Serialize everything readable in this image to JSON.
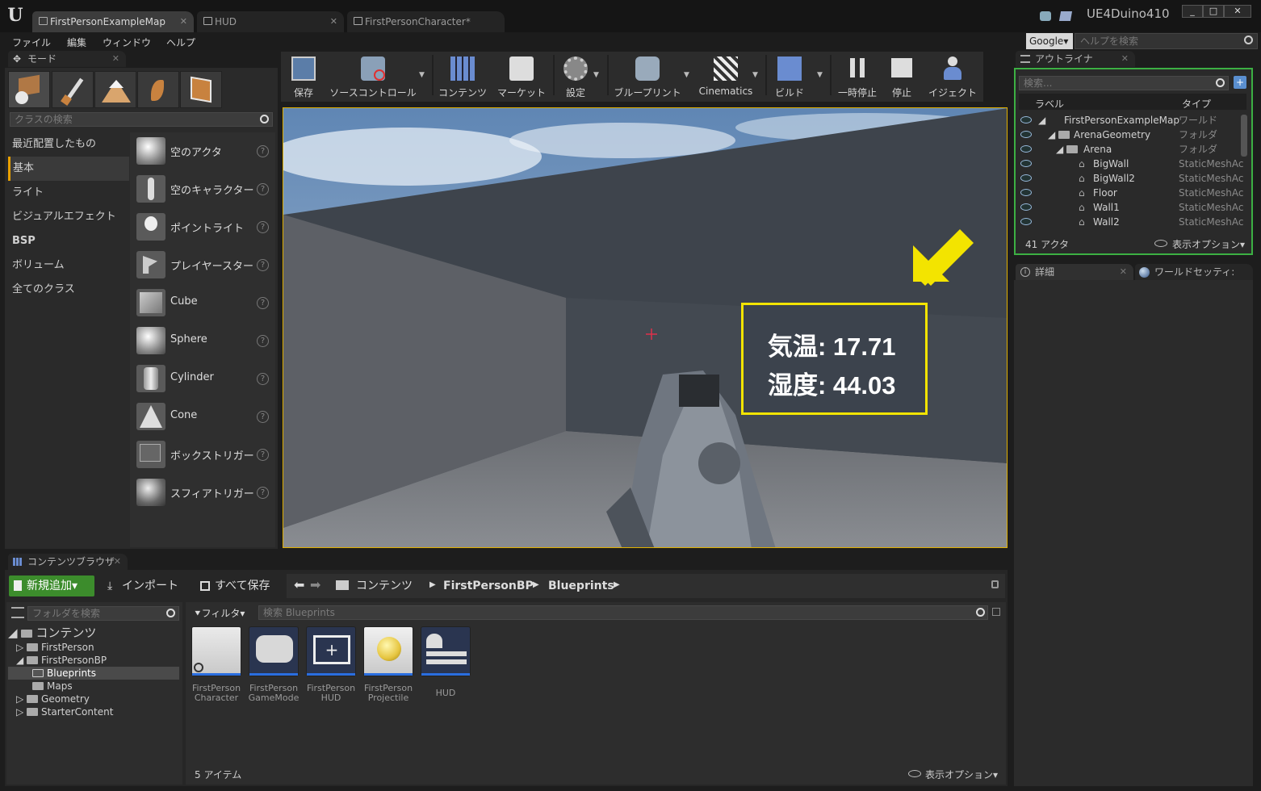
{
  "window": {
    "tabs": [
      {
        "label": "FirstPersonExampleMap"
      },
      {
        "label": "HUD"
      },
      {
        "label": "FirstPersonCharacter*"
      }
    ],
    "project_name": "UE4Duino410",
    "controls": [
      "_",
      "□",
      "✕"
    ]
  },
  "menu": {
    "items": [
      "ファイル",
      "編集",
      "ウィンドウ",
      "ヘルプ"
    ],
    "search_engine": "Google▾",
    "help_search_placeholder": "ヘルプを検索"
  },
  "modes_panel": {
    "title": "モード",
    "class_search_placeholder": "クラスの検索",
    "categories": [
      "最近配置したもの",
      "基本",
      "ライト",
      "ビジュアルエフェクト",
      "BSP",
      "ボリューム",
      "全てのクラス"
    ],
    "selected_category": "基本",
    "items": [
      {
        "label": "空のアクタ"
      },
      {
        "label": "空のキャラクター"
      },
      {
        "label": "ポイントライト"
      },
      {
        "label": "プレイヤースター"
      },
      {
        "label": "Cube"
      },
      {
        "label": "Sphere"
      },
      {
        "label": "Cylinder"
      },
      {
        "label": "Cone"
      },
      {
        "label": "ボックストリガー"
      },
      {
        "label": "スフィアトリガー"
      }
    ],
    "help_glyph": "?"
  },
  "toolbar": {
    "buttons": [
      {
        "label": "保存"
      },
      {
        "label": "ソースコントロール"
      },
      {
        "label": "コンテンツ"
      },
      {
        "label": "マーケット"
      },
      {
        "label": "設定"
      },
      {
        "label": "ブループリント"
      },
      {
        "label": "Cinematics"
      },
      {
        "label": "ビルド"
      },
      {
        "label": "一時停止"
      },
      {
        "label": "停止"
      },
      {
        "label": "イジェクト"
      }
    ]
  },
  "viewport": {
    "hud_lines": [
      "気温: 17.71",
      "湿度: 44.03"
    ],
    "highlight_color": "#f3e400",
    "arrow_color": "#f3e400"
  },
  "outliner": {
    "title": "アウトライナ",
    "search_placeholder": "検索...",
    "col_label": "ラベル",
    "col_type": "タイプ",
    "rows": [
      {
        "label": "FirstPersonExampleMap",
        "type": "ワールド"
      },
      {
        "label": "ArenaGeometry",
        "type": "フォルダ"
      },
      {
        "label": "Arena",
        "type": "フォルダ"
      },
      {
        "label": "BigWall",
        "type": "StaticMeshAc"
      },
      {
        "label": "BigWall2",
        "type": "StaticMeshAc"
      },
      {
        "label": "Floor",
        "type": "StaticMeshAc"
      },
      {
        "label": "Wall1",
        "type": "StaticMeshAc"
      },
      {
        "label": "Wall2",
        "type": "StaticMeshAc"
      }
    ],
    "actor_count": "41 アクタ",
    "view_options": "表示オプション▾"
  },
  "details": {
    "tab_details": "詳細",
    "tab_world_settings": "ワールドセッティ:"
  },
  "content_browser": {
    "title": "コンテンツブラウザ",
    "add_new": "新規追加▾",
    "import": "インポート",
    "save_all": "すべて保存",
    "path": [
      "コンテンツ",
      "FirstPersonBP",
      "Blueprints"
    ],
    "folder_search_placeholder": "フォルダを検索",
    "filter": "フィルタ▾",
    "asset_search_placeholder": "検索 Blueprints",
    "tree": [
      {
        "label": "コンテンツ"
      },
      {
        "label": "FirstPerson"
      },
      {
        "label": "FirstPersonBP"
      },
      {
        "label": "Blueprints"
      },
      {
        "label": "Maps"
      },
      {
        "label": "Geometry"
      },
      {
        "label": "StarterContent"
      }
    ],
    "assets": [
      {
        "line1": "FirstPerson",
        "line2": "Character"
      },
      {
        "line1": "FirstPerson",
        "line2": "GameMode"
      },
      {
        "line1": "FirstPerson",
        "line2": "HUD"
      },
      {
        "line1": "FirstPerson",
        "line2": "Projectile"
      },
      {
        "line1": "HUD",
        "line2": ""
      }
    ],
    "item_count": "5 アイテム",
    "view_options": "表示オプション▾"
  }
}
